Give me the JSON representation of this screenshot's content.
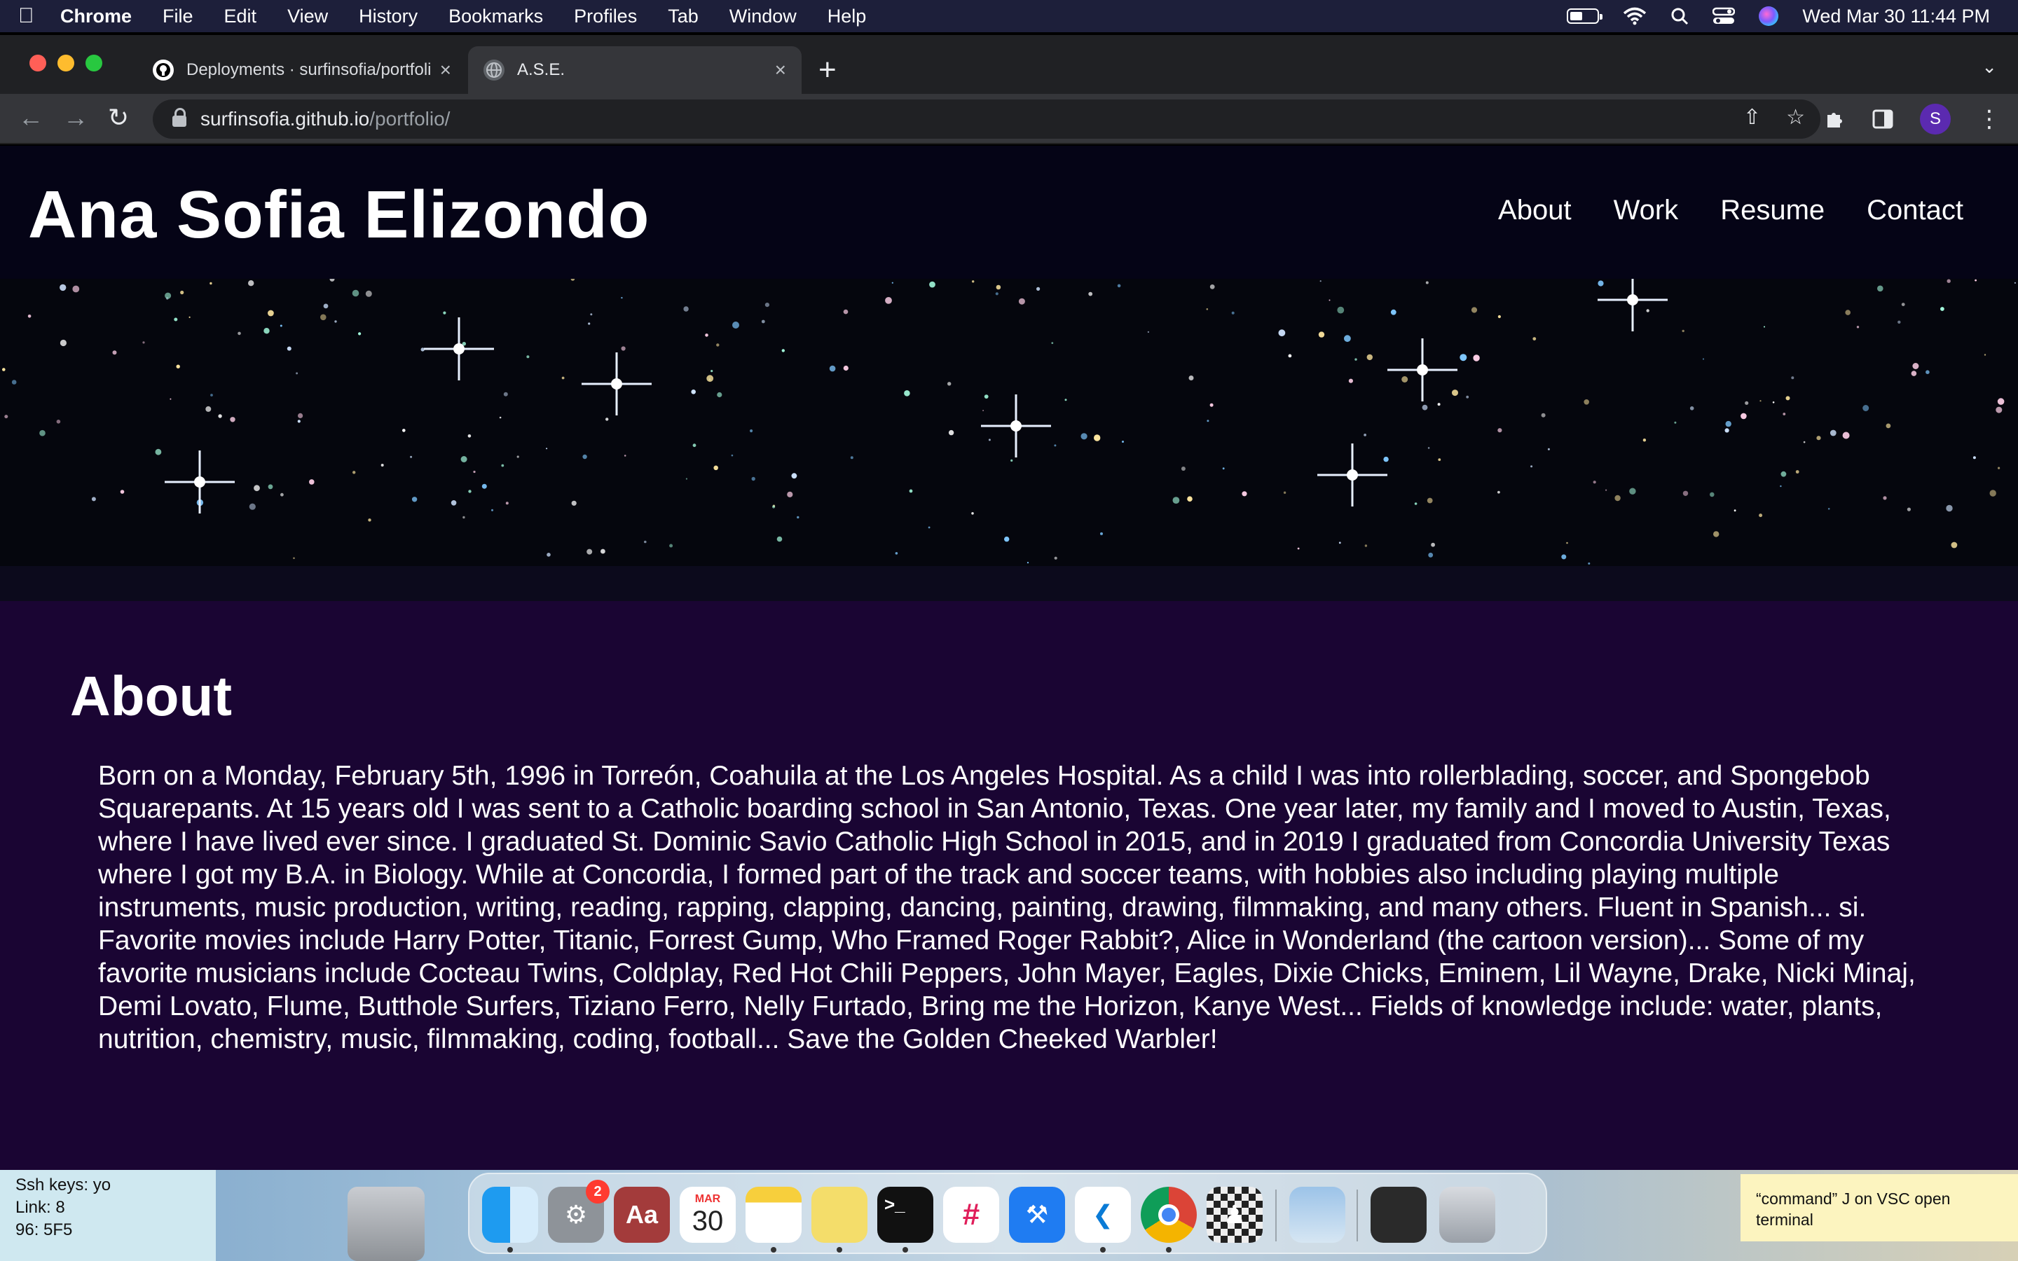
{
  "menubar": {
    "app": "Chrome",
    "items": [
      "File",
      "Edit",
      "View",
      "History",
      "Bookmarks",
      "Profiles",
      "Tab",
      "Window",
      "Help"
    ],
    "clock": "Wed Mar 30  11:44 PM",
    "battery_level": 0.45
  },
  "browser": {
    "tabs": [
      {
        "title": "Deployments · surfinsofia/portfolio",
        "icon": "github-icon",
        "close": "×"
      },
      {
        "title": "A.S.E.",
        "icon": "globe-icon",
        "close": "×"
      }
    ],
    "new_tab": "+",
    "url_host": "surfinsofia.github.io",
    "url_path": "/portfolio/",
    "profile_initial": "S"
  },
  "site": {
    "title": "Ana Sofia Elizondo",
    "nav": [
      "About",
      "Work",
      "Resume",
      "Contact"
    ],
    "about_heading": "About",
    "about_text": "Born on a Monday, February 5th, 1996 in Torreón, Coahuila at the Los Angeles Hospital. As a child I was into rollerblading, soccer, and Spongebob Squarepants. At 15 years old I was sent to a Catholic boarding school in San Antonio, Texas. One year later, my family and I moved to Austin, Texas, where I have lived ever since. I graduated St. Dominic Savio Catholic High School in 2015, and in 2019 I graduated from Concordia University Texas where I got my B.A. in Biology. While at Concordia, I formed part of the track and soccer teams, with hobbies also including playing multiple instruments, music production, writing, reading, rapping, clapping, dancing, painting, drawing, filmmaking, and many others. Fluent in Spanish... si. Favorite movies include Harry Potter, Titanic, Forrest Gump, Who Framed Roger Rabbit?, Alice in Wonderland (the cartoon version)... Some of my favorite musicians include Cocteau Twins, Coldplay, Red Hot Chili Peppers, John Mayer, Eagles, Dixie Chicks, Eminem, Lil Wayne, Drake, Nicki Minaj, Demi Lovato, Flume, Butthole Surfers, Tiziano Ferro, Nelly Furtado, Bring me the Horizon, Kanye West... Fields of knowledge include: water, plants, nutrition, chemistry, music, filmmaking, coding, football... Save the Golden Cheeked Warbler!"
  },
  "desktop": {
    "sticky_left": [
      "Ssh keys: yo",
      "Link: 8",
      "96: 5F5"
    ],
    "sticky_right": "“command” J on VSC open terminal",
    "dock_badge": "2",
    "calendar_month": "MAR",
    "calendar_day": "30",
    "dictionary_label": "Aa"
  },
  "colors": {
    "page_bg": "#1a0533",
    "header_bg": "#050416",
    "menubar_bg": "#1d1f3a",
    "chrome_dark": "#202124",
    "chrome_toolbar": "#35363a"
  }
}
